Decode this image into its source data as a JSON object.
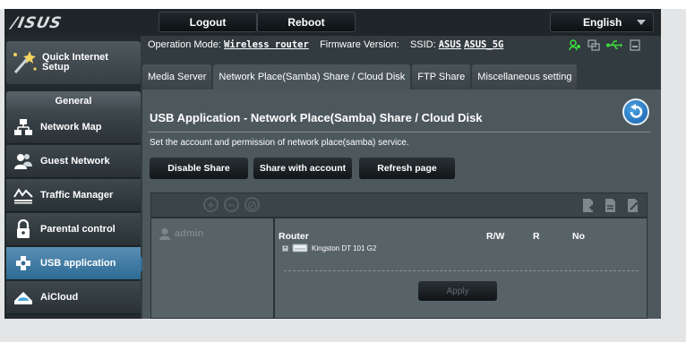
{
  "header": {
    "logo": "/ISUS",
    "logout_label": "Logout",
    "reboot_label": "Reboot",
    "language": "English"
  },
  "sidebar": {
    "qis_label_1": "Quick Internet",
    "qis_label_2": "Setup",
    "section": "General",
    "items": [
      {
        "label": "Network Map",
        "icon": "network-map-icon"
      },
      {
        "label": "Guest Network",
        "icon": "guest-network-icon"
      },
      {
        "label": "Traffic Manager",
        "icon": "traffic-manager-icon"
      },
      {
        "label": "Parental control",
        "icon": "parental-control-icon"
      },
      {
        "label": "USB application",
        "icon": "usb-application-icon",
        "active": true
      },
      {
        "label": "AiCloud",
        "icon": "aicloud-icon"
      }
    ]
  },
  "info": {
    "opmode_label": "Operation Mode:",
    "opmode_value": "Wireless router",
    "fw_label": "Firmware Version:",
    "ssid_label": "SSID:",
    "ssid_1": "ASUS",
    "ssid_2": "ASUS_5G"
  },
  "tabs": [
    {
      "label": "Media Server"
    },
    {
      "label": "Network Place(Samba) Share / Cloud Disk",
      "active": true
    },
    {
      "label": "FTP Share"
    },
    {
      "label": "Miscellaneous setting"
    }
  ],
  "panel": {
    "title": "USB Application - Network Place(Samba) Share / Cloud Disk",
    "description": "Set the account and permission of network place(samba) service.",
    "buttons": {
      "disable": "Disable Share",
      "share": "Share with account",
      "refresh": "Refresh page"
    },
    "user": "admin",
    "columns": {
      "name": "Router",
      "rw": "R/W",
      "r": "R",
      "no": "No"
    },
    "drive": "Kingston DT 101 G2",
    "apply": "Apply"
  },
  "colors": {
    "accent_active": "#2f6d96",
    "status_green": "#3ddc3d"
  }
}
